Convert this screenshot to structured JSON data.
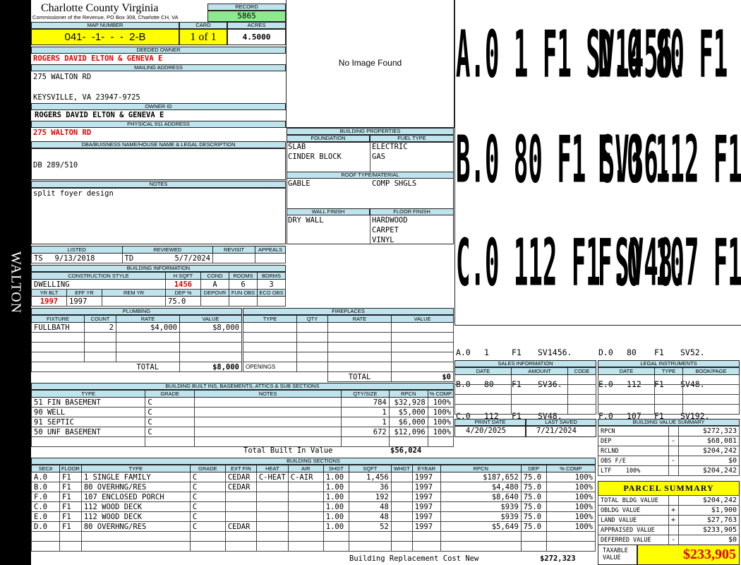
{
  "spine": "WALTON",
  "header": {
    "county": "Charlotte County Virginia",
    "address_line": "Commissioner of the Revenue, PO Box 308, Charlotte CH, VA",
    "record_label": "RECORD",
    "record": "5865",
    "map_label": "MAP NUMBER",
    "map_number": "041-  -1-  -  -  2-B",
    "card_label": "CARD",
    "card": "1 of 1",
    "acres_label": "ACRES",
    "acres": "4.5000"
  },
  "owner": {
    "deeded_label": "DEEDED OWNER",
    "deeded": "ROGERS DAVID ELTON & GENEVA E",
    "mailing_label": "MAILING ADDRESS",
    "mailing1": "275 WALTON RD",
    "mailing2": "KEYSVILLE, VA 23947-9725",
    "owner_id_label": "OWNER ID",
    "owner_id": "ROGERS DAVID ELTON & GENEVA E",
    "physical_label": "PHYSICAL 911 ADDRESS",
    "physical": "275 WALTON RD",
    "dba_label": "DBA/BUISNESS NAME/HOUSE NAME & LEGAL DESCRIPTION",
    "dba": "DB 289/510",
    "notes_label": "NOTES",
    "notes": "split foyer design"
  },
  "image": {
    "no_image": "No Image Found"
  },
  "building_props": {
    "title": "BUILDING PROPERTIES",
    "foundation_label": "FOUNDATION",
    "foundation": [
      "SLAB",
      "CINDER BLOCK"
    ],
    "fuel_label": "FUEL TYPE",
    "fuel": [
      "ELECTRIC",
      "GAS"
    ],
    "roof_label": "ROOF TYPE/MATERIAL",
    "roof_type": "GABLE",
    "roof_material": "COMP SHGLS",
    "wall_label": "WALL FINISH",
    "wall": "DRY WALL",
    "floor_label": "FLOOR FINISH",
    "floor": [
      "HARDWOOD",
      "CARPET",
      "VINYL"
    ]
  },
  "sketch": {
    "rows": [
      [
        "A.0",
        "1",
        "F1",
        "SV1456.",
        "D.0",
        "80",
        "F1",
        "SV52."
      ],
      [
        "B.0",
        "80",
        "F1",
        "SV36.",
        "E.0",
        "112",
        "F1",
        "SV48."
      ],
      [
        "C.0",
        "112",
        "F1",
        "SV48.",
        "F.0",
        "107",
        "F1",
        "SV192."
      ]
    ]
  },
  "listing": {
    "listed_label": "LISTED",
    "listed_by": "TS",
    "listed_date": "9/13/2018",
    "reviewed_label": "REVIEWED",
    "reviewed_by": "TD",
    "reviewed_date": "5/7/2024",
    "revisit_label": "REVISIT",
    "appeals_label": "APPEALS"
  },
  "building_info": {
    "title": "BUILDING INFORMATION",
    "style_label": "CONSTRUCTION STYLE",
    "style": "DWELLING",
    "hsqft_label": "H SQFT",
    "hsqft": "1456",
    "cond_label": "COND",
    "cond": "A",
    "rooms_label": "ROOMS",
    "rooms": "6",
    "bdrms_label": "BDRMS",
    "bdrms": "3",
    "yrblt_label": "YR BLT",
    "yrblt": "1997",
    "effyr_label": "EFF YR",
    "effyr": "1997",
    "remyr_label": "REM YR",
    "deppct_label": "DEP %",
    "deppct": "75.0",
    "depovr_label": "DEPOVR",
    "funobs_label": "FUN OBS",
    "ecoobs_label": "ECO OBS"
  },
  "plumbing": {
    "title": "PLUMBING",
    "headers": [
      "FIXTURE",
      "COUNT",
      "RATE",
      "VALUE"
    ],
    "rows": [
      [
        "FULLBATH",
        "2",
        "$4,000",
        "$8,000"
      ]
    ],
    "total_label": "TOTAL",
    "total": "$8,000"
  },
  "fireplaces": {
    "title": "FIREPLACES",
    "headers": [
      "TYPE",
      "QTY",
      "RATE",
      "VALUE"
    ],
    "openings_label": "OPENINGS",
    "total_label": "TOTAL",
    "total": "$0"
  },
  "builtins": {
    "title": "BUILDING BUILT INS, BASEMENTS, ATTICS & SUB SECTIONS",
    "headers": [
      "TYPE",
      "GRADE",
      "NOTES",
      "QTY/SIZE",
      "RPCN",
      "% COMP"
    ],
    "rows": [
      [
        "51 FIN BASEMENT",
        "C",
        "",
        "784",
        "$32,928",
        "100%"
      ],
      [
        "90 WELL",
        "C",
        "",
        "1",
        "$5,000",
        "100%"
      ],
      [
        "91 SEPTIC",
        "C",
        "",
        "1",
        "$6,000",
        "100%"
      ],
      [
        "50 UNF BASEMENT",
        "C",
        "",
        "672",
        "$12,096",
        "100%"
      ]
    ],
    "total_label": "Total Built In Value",
    "total": "$56,024"
  },
  "sections": {
    "title": "BUILDING SECTIONS",
    "headers": [
      "SEC#",
      "FLOOR",
      "TYPE",
      "GRADE",
      "EXT FIN",
      "HEAT",
      "AIR",
      "SHGT",
      "SQFT",
      "WHGT",
      "EYEAR",
      "RPCN",
      "DEP",
      "% COMP"
    ],
    "rows": [
      [
        "A.0",
        "F1",
        "1 SINGLE FAMILY",
        "C",
        "CEDAR",
        "C-HEAT",
        "C-AIR",
        "1.00",
        "1,456",
        "",
        "1997",
        "$187,652",
        "75.0",
        "100%"
      ],
      [
        "B.0",
        "F1",
        "80 OVERHNG/RES",
        "C",
        "CEDAR",
        "",
        "",
        "1.00",
        "36",
        "",
        "1997",
        "$4,480",
        "75.0",
        "100%"
      ],
      [
        "F.0",
        "F1",
        "107 ENCLOSED PORCH",
        "C",
        "",
        "",
        "",
        "1.00",
        "192",
        "",
        "1997",
        "$8,640",
        "75.0",
        "100%"
      ],
      [
        "C.0",
        "F1",
        "112 WOOD DECK",
        "C",
        "",
        "",
        "",
        "1.00",
        "48",
        "",
        "1997",
        "$939",
        "75.0",
        "100%"
      ],
      [
        "E.0",
        "F1",
        "112 WOOD DECK",
        "C",
        "",
        "",
        "",
        "1.00",
        "48",
        "",
        "1997",
        "$939",
        "75.0",
        "100%"
      ],
      [
        "D.0",
        "F1",
        "80 OVERHNG/RES",
        "C",
        "CEDAR",
        "",
        "",
        "1.00",
        "52",
        "",
        "1997",
        "$5,649",
        "75.0",
        "100%"
      ]
    ],
    "total_label": "Building Replacement Cost New",
    "total": "$272,323"
  },
  "sales": {
    "title": "SALES INFORMATION",
    "headers": [
      "DATE",
      "AMOUNT",
      "CODE"
    ]
  },
  "legal": {
    "title": "LEGAL INSTRUMENTS",
    "headers": [
      "DATE",
      "TYPE",
      "BOOK/PAGE"
    ]
  },
  "print": {
    "print_label": "PRINT DATE",
    "print_date": "4/20/2025",
    "saved_label": "LAST SAVED",
    "saved_date": "7/21/2024"
  },
  "value_summary": {
    "title": "BUILDING VALUE SUMMARY",
    "rows": [
      [
        "RPCN",
        "",
        "$272,323"
      ],
      [
        "DEP",
        "-",
        "$68,081"
      ],
      [
        "RCLND",
        "",
        "$204,242"
      ],
      [
        "OBS F/E",
        "-",
        "$0"
      ],
      [
        "LTF    100%",
        "",
        "$204,242"
      ]
    ]
  },
  "parcel": {
    "title": "PARCEL SUMMARY",
    "rows": [
      [
        "TOTAL BLDG VALUE",
        "",
        "$204,242"
      ],
      [
        "OBLDG VALUE",
        "+",
        "$1,900"
      ],
      [
        "LAND VALUE",
        "+",
        "$27,763"
      ],
      [
        "APPRAISED VALUE",
        "",
        "$233,905"
      ],
      [
        "DEFERRED VALUE",
        "-",
        "$0"
      ]
    ],
    "taxable_label": "TAXABLE VALUE",
    "taxable": "$233,905"
  },
  "colors": {
    "header_fill": "#bfe4ee",
    "yellow": "#ffff00",
    "green": "#8ee88e",
    "red_text": "#e00000"
  }
}
